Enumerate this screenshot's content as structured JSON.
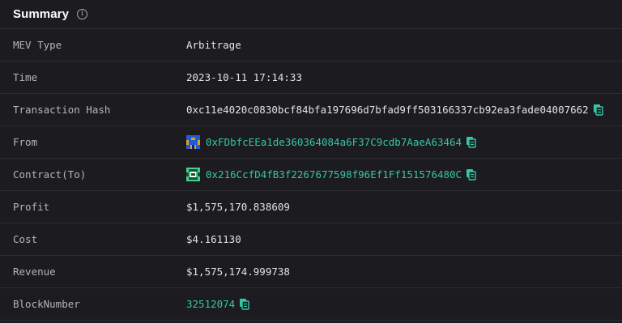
{
  "summary": {
    "title": "Summary",
    "info_icon": "info-icon"
  },
  "rows": {
    "mev_type": {
      "label": "MEV Type",
      "value": "Arbitrage"
    },
    "time": {
      "label": "Time",
      "value": "2023-10-11 17:14:33"
    },
    "tx_hash": {
      "label": "Transaction Hash",
      "value": "0xc11e4020c0830bcf84bfa197696d7bfad9ff503166337cb92ea3fade04007662"
    },
    "from": {
      "label": "From",
      "value": "0xFDbfcEEa1de360364084a6F37C9cdb7AaeA63464"
    },
    "contract": {
      "label": "Contract(To)",
      "value": "0x216CcfD4fB3f2267677598f96Ef1Ff151576480C"
    },
    "profit": {
      "label": "Profit",
      "value": "$1,575,170.838609"
    },
    "cost": {
      "label": "Cost",
      "value": "$4.161130"
    },
    "revenue": {
      "label": "Revenue",
      "value": "$1,575,174.999738"
    },
    "block_number": {
      "label": "BlockNumber",
      "value": "32512074"
    }
  },
  "colors": {
    "background": "#1c1c20",
    "divider": "#2c2c31",
    "link": "#35c6a5",
    "label": "#b4b4ba",
    "value": "#e2e2e6"
  },
  "icons": {
    "copy": "copy-icon",
    "from_avatar": "identicon-avatar-blue",
    "contract_avatar": "identicon-avatar-green"
  }
}
